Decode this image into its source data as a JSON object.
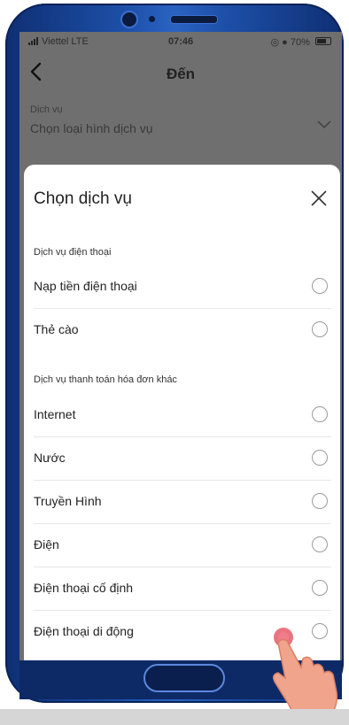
{
  "status_bar": {
    "carrier": "Viettel  LTE",
    "time": "07:46",
    "battery": "70%"
  },
  "header": {
    "title": "Đến"
  },
  "service_field": {
    "label": "Dịch vụ",
    "placeholder": "Chọn loại hình dịch vụ"
  },
  "sheet": {
    "title": "Chọn dịch vụ",
    "sections": [
      {
        "label": "Dịch vụ điện thoại",
        "options": [
          "Nạp tiền điện thoại",
          "Thẻ cào"
        ]
      },
      {
        "label": "Dịch vụ thanh toán hóa đơn khác",
        "options": [
          "Internet",
          "Nước",
          "Truyền Hình",
          "Điện",
          "Điện thoại cố định",
          "Điện thoại di động"
        ]
      }
    ]
  },
  "colors": {
    "frame": "#1d4fa8",
    "overlay": "#6f6f6f",
    "tap_indicator": "#e85a6a"
  }
}
